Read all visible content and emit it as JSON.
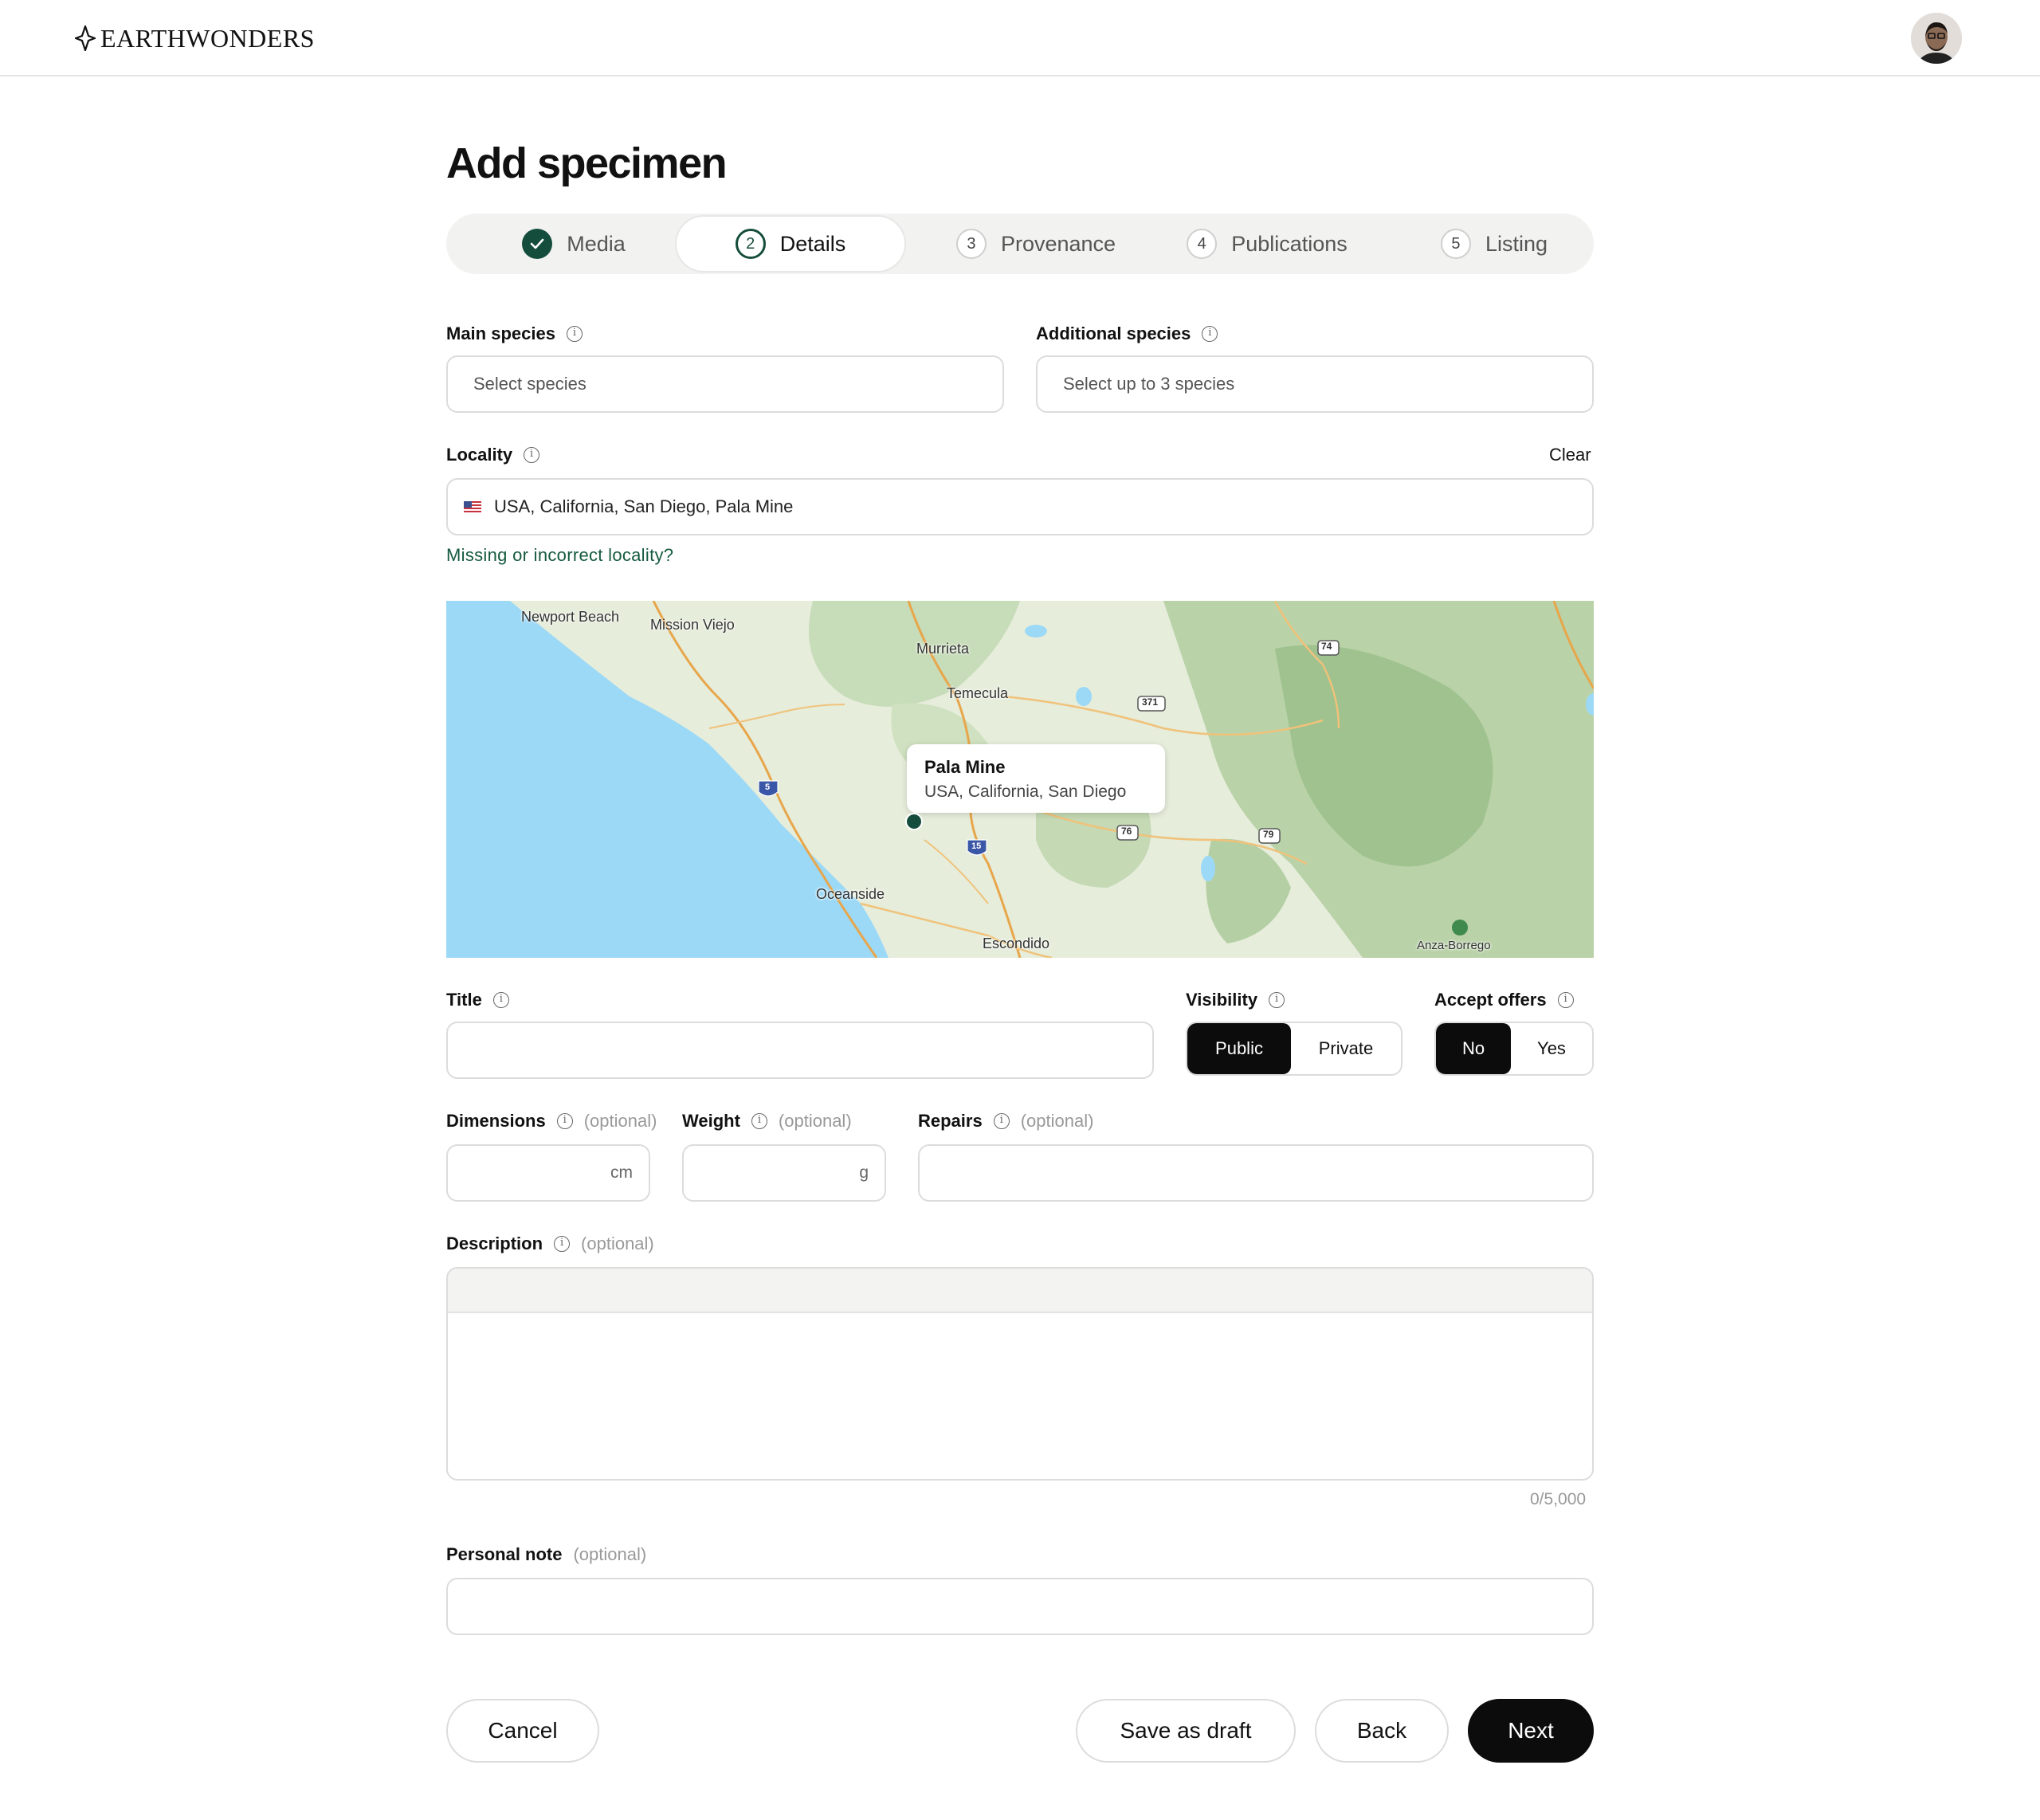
{
  "header": {
    "logo_text": "EARTHWONDERS",
    "avatar_icon": "user-avatar-photo"
  },
  "page": {
    "title": "Add specimen"
  },
  "stepper": {
    "steps": [
      {
        "num": "",
        "label": "Media",
        "state": "done"
      },
      {
        "num": "2",
        "label": "Details",
        "state": "active"
      },
      {
        "num": "3",
        "label": "Provenance",
        "state": "todo"
      },
      {
        "num": "4",
        "label": "Publications",
        "state": "todo"
      },
      {
        "num": "5",
        "label": "Listing",
        "state": "todo"
      }
    ]
  },
  "form": {
    "main_species": {
      "label": "Main species",
      "placeholder": "Select species"
    },
    "additional_species": {
      "label": "Additional species",
      "placeholder": "Select up to 3 species"
    },
    "locality": {
      "label": "Locality",
      "clear_label": "Clear",
      "value": "USA, California, San Diego, Pala Mine",
      "flag_icon": "us-flag-icon",
      "missing_link": "Missing or incorrect locality?"
    },
    "title": {
      "label": "Title",
      "value": ""
    },
    "visibility": {
      "label": "Visibility",
      "options": [
        "Public",
        "Private"
      ],
      "selected": "Public"
    },
    "accept_offers": {
      "label": "Accept offers",
      "options": [
        "No",
        "Yes"
      ],
      "selected": "No"
    },
    "dimensions": {
      "label": "Dimensions",
      "optional": "(optional)",
      "unit": "cm"
    },
    "weight": {
      "label": "Weight",
      "optional": "(optional)",
      "unit": "g"
    },
    "repairs": {
      "label": "Repairs",
      "optional": "(optional)"
    },
    "description": {
      "label": "Description",
      "optional": "(optional)",
      "counter": "0/5,000"
    },
    "personal_note": {
      "label": "Personal note",
      "optional": "(optional)"
    }
  },
  "map": {
    "tooltip_title": "Pala Mine",
    "tooltip_subtitle": "USA, California, San Diego",
    "places": {
      "newport_beach": "Newport Beach",
      "mission_viejo": "Mission Viejo",
      "murrieta": "Murrieta",
      "temecula": "Temecula",
      "oceanside": "Oceanside",
      "escondido": "Escondido",
      "anza_borrego": "Anza-Borrego"
    },
    "routes": {
      "r74": "74",
      "r371": "371",
      "r76": "76",
      "r79": "79",
      "i5": "5",
      "i15": "15"
    },
    "colors": {
      "water": "#9cd9f7",
      "land": "#e9efdf",
      "forest": "#a9c99a",
      "road": "#e8a64b"
    }
  },
  "actions": {
    "cancel": "Cancel",
    "save_draft": "Save as draft",
    "back": "Back",
    "next": "Next"
  },
  "colors": {
    "accent_green": "#154d3c",
    "primary_button": "#0c0c0c",
    "border": "#dcdcdc"
  }
}
